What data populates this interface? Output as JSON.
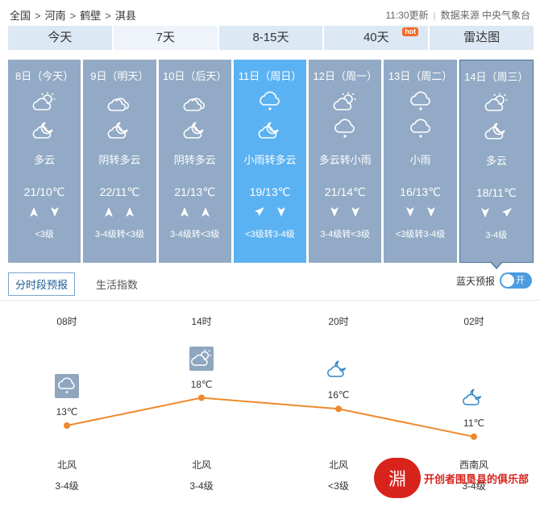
{
  "breadcrumb": {
    "items": [
      "全国",
      "河南",
      "鹤壁",
      "淇县"
    ],
    "sep": ">"
  },
  "meta": {
    "updated": "11:30更新",
    "source": "数据来源 中央气象台",
    "divider": "|"
  },
  "tabs": [
    {
      "label": "今天"
    },
    {
      "label": "7天"
    },
    {
      "label": "8-15天"
    },
    {
      "label": "40天",
      "badge": "hot"
    },
    {
      "label": "雷达图"
    }
  ],
  "days": [
    {
      "date": "8日（今天）",
      "icon1": "partly-cloudy-icon",
      "icon2": "cloudy-night-icon",
      "desc": "多云",
      "temp": "21/10℃",
      "arrows": [
        "up",
        "down"
      ],
      "wind": "<3级"
    },
    {
      "date": "9日（明天）",
      "icon1": "overcast-icon",
      "icon2": "cloudy-night-icon",
      "desc": "阴转多云",
      "temp": "22/11℃",
      "arrows": [
        "up",
        "up"
      ],
      "wind": "3-4级转<3级"
    },
    {
      "date": "10日（后天）",
      "icon1": "overcast-icon",
      "icon2": "cloudy-night-icon",
      "desc": "阴转多云",
      "temp": "21/13℃",
      "arrows": [
        "up",
        "up"
      ],
      "wind": "3-4级转<3级"
    },
    {
      "date": "11日（周日）",
      "icon1": "light-rain-icon",
      "icon2": "cloudy-night-icon",
      "desc": "小雨转多云",
      "temp": "19/13℃",
      "arrows": [
        "up-right",
        "down"
      ],
      "wind": "<3级转3-4级"
    },
    {
      "date": "12日（周一）",
      "icon1": "partly-cloudy-icon",
      "icon2": "light-rain-icon",
      "desc": "多云转小雨",
      "temp": "21/14℃",
      "arrows": [
        "down",
        "down"
      ],
      "wind": "3-4级转<3级"
    },
    {
      "date": "13日（周二）",
      "icon1": "light-rain-icon",
      "icon2": "light-rain-icon",
      "desc": "小雨",
      "temp": "16/13℃",
      "arrows": [
        "down",
        "down"
      ],
      "wind": "<3级转3-4级"
    },
    {
      "date": "14日（周三）",
      "icon1": "partly-cloudy-icon",
      "icon2": "cloudy-night-icon",
      "desc": "多云",
      "temp": "18/11℃",
      "arrows": [
        "down",
        "up-right"
      ],
      "wind": "3-4级"
    }
  ],
  "subtabs": {
    "hourly": "分时段预报",
    "life": "生活指数"
  },
  "bluesky": {
    "label": "蓝天预报",
    "toggle": "开"
  },
  "hourly": [
    {
      "time": "08时",
      "icon": "light-rain-icon",
      "temp": "13℃",
      "temp_value": 13,
      "wind_dir": "北风",
      "wind_level": "3-4级"
    },
    {
      "time": "14时",
      "icon": "partly-cloudy-icon",
      "temp": "18℃",
      "temp_value": 18,
      "wind_dir": "北风",
      "wind_level": "3-4级"
    },
    {
      "time": "20时",
      "icon": "cloudy-night-icon",
      "temp": "16℃",
      "temp_value": 16,
      "wind_dir": "北风",
      "wind_level": "<3级"
    },
    {
      "time": "02时",
      "icon": "cloudy-night-icon",
      "temp": "11℃",
      "temp_value": 11,
      "wind_dir": "西南风",
      "wind_level": "3-4级"
    }
  ],
  "watermark": {
    "seal": "淵",
    "text": "开创者围垦县的俱乐部"
  },
  "colors": {
    "card": "#92aac5",
    "card_highlight": "#5bb2f2",
    "tab": "#dce8f4",
    "line": "#f0892a",
    "hot": "#f26a25"
  }
}
